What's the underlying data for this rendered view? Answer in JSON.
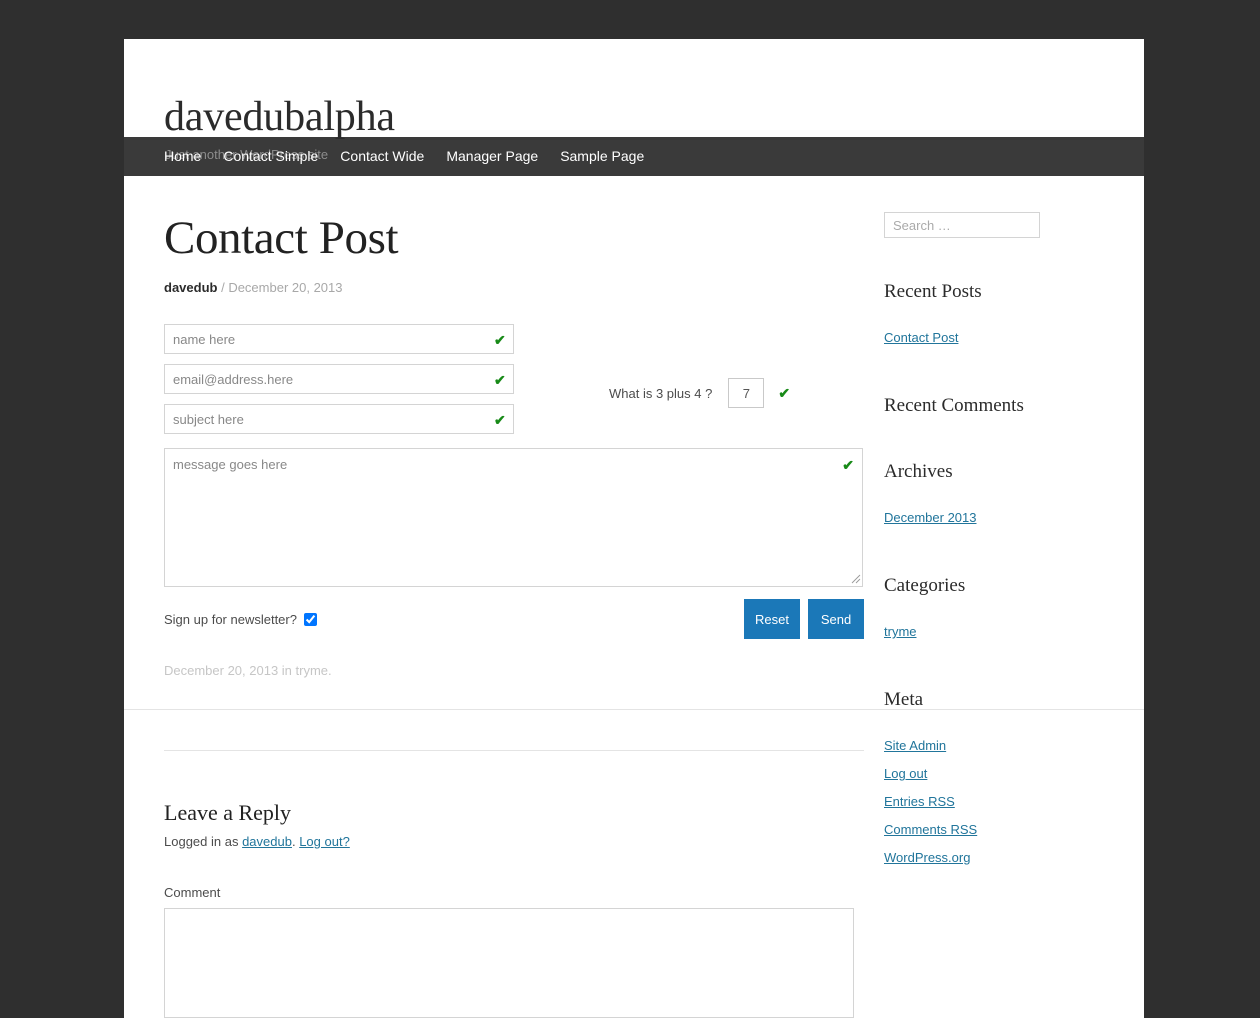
{
  "site": {
    "title": "davedubalpha",
    "description": "Just another WordPress site"
  },
  "nav": {
    "items": [
      {
        "label": "Home"
      },
      {
        "label": "Contact Simple"
      },
      {
        "label": "Contact Wide"
      },
      {
        "label": "Manager Page"
      },
      {
        "label": "Sample Page"
      }
    ]
  },
  "post": {
    "title": "Contact Post",
    "author": "davedub",
    "meta_separator": " / ",
    "date": "December 20, 2013",
    "footer_meta": "December 20, 2013 in tryme."
  },
  "contact_form": {
    "name_placeholder": "name here",
    "name_value": "",
    "email_placeholder": "email@address.here",
    "email_value": "",
    "subject_placeholder": "subject here",
    "subject_value": "",
    "message_placeholder": "message goes here",
    "message_value": "",
    "captcha_question": "What is 3 plus 4 ?",
    "captcha_value": "7",
    "newsletter_label": "Sign up for newsletter?",
    "newsletter_checked": true,
    "valid_mark": "✔",
    "reset_label": "Reset",
    "send_label": "Send",
    "valid_color": "#188a18",
    "button_color": "#1b78b8"
  },
  "comments": {
    "reply_title": "Leave a Reply",
    "logged_in_prefix": "Logged in as ",
    "logged_in_user": "davedub",
    "logged_in_separator": ". ",
    "logout_label": "Log out?",
    "comment_label": "Comment",
    "comment_value": ""
  },
  "sidebar": {
    "search_placeholder": "Search …",
    "search_value": "",
    "widgets": [
      {
        "title": "Recent Posts",
        "links": [
          {
            "label": "Contact Post"
          }
        ]
      },
      {
        "title": "Recent Comments",
        "links": []
      },
      {
        "title": "Archives",
        "links": [
          {
            "label": "December 2013"
          }
        ]
      },
      {
        "title": "Categories",
        "links": [
          {
            "label": "tryme"
          }
        ]
      },
      {
        "title": "Meta",
        "links": [
          {
            "label": "Site Admin"
          },
          {
            "label": "Log out"
          },
          {
            "label": "Entries RSS"
          },
          {
            "label": "Comments RSS"
          },
          {
            "label": "WordPress.org"
          }
        ]
      }
    ]
  },
  "theme": {
    "background": "#2f2f2f",
    "nav_background": "#3a3a3a",
    "link_color": "#21759b"
  }
}
